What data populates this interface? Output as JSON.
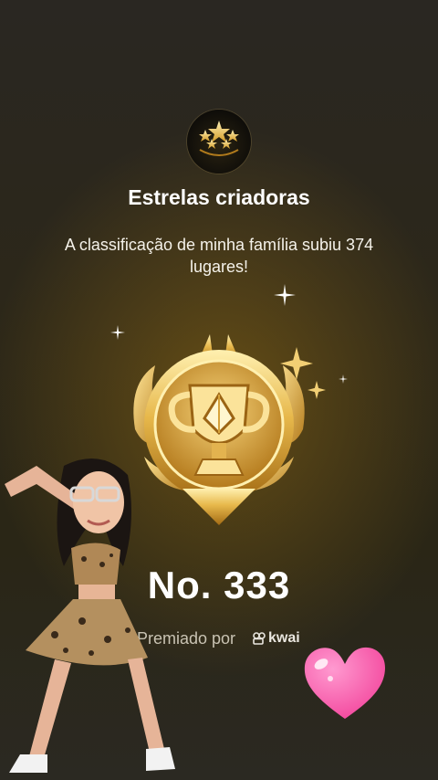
{
  "header": {
    "badge_icon": "stars-icon",
    "title": "Estrelas criadoras",
    "subtitle": "A classificação de minha família subiu 374 lugares!"
  },
  "medal": {
    "icon": "trophy-medal-icon"
  },
  "rank": {
    "label": "No. 333"
  },
  "footer": {
    "awarded_by": "Premiado por",
    "brand": "kwai"
  },
  "decorations": {
    "sticker": "heart-icon",
    "avatar": "dancing-avatar"
  },
  "colors": {
    "gold": "#e6b84a",
    "heart": "#ff6fb0",
    "text": "#ffffff",
    "muted": "#c9c3b3"
  }
}
